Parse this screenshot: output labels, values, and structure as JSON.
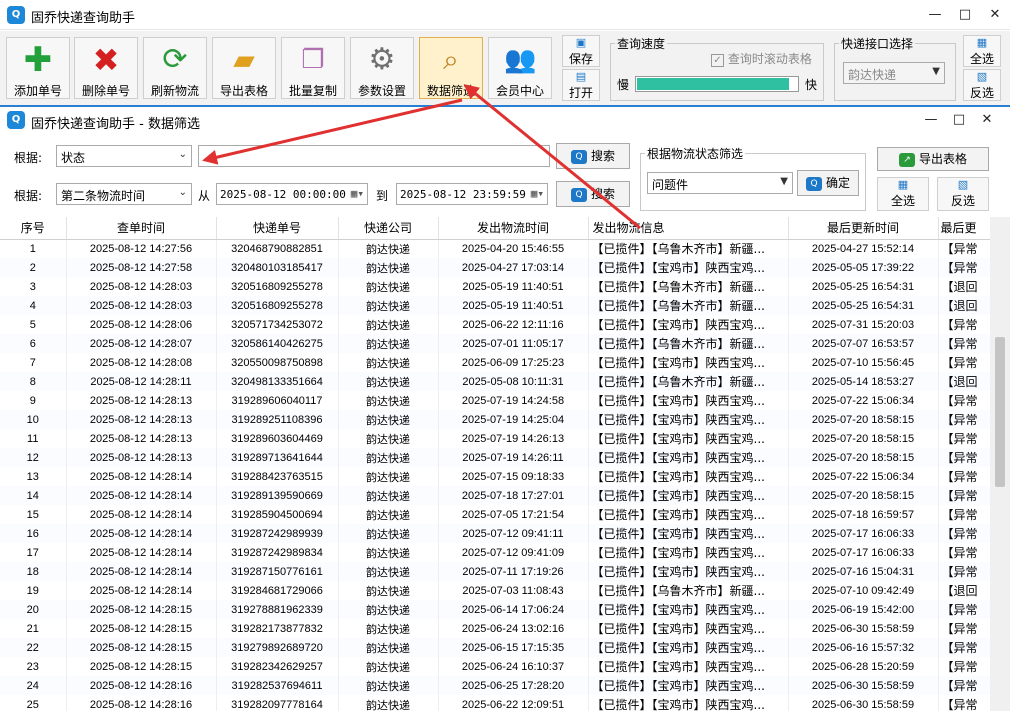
{
  "app": {
    "title": "固乔快递查询助手",
    "child_title": "固乔快递查询助手 - 数据筛选",
    "logo_text": "Q"
  },
  "window_controls": {
    "minimize": "—",
    "maximize": "□",
    "close": "✕"
  },
  "toolbar": {
    "buttons": [
      {
        "label": "添加单号",
        "icon": "plus-icon"
      },
      {
        "label": "删除单号",
        "icon": "delete-icon"
      },
      {
        "label": "刷新物流",
        "icon": "refresh-icon"
      },
      {
        "label": "导出表格",
        "icon": "export-folder-icon"
      },
      {
        "label": "批量复制",
        "icon": "copy-icon"
      },
      {
        "label": "参数设置",
        "icon": "gear-icon"
      },
      {
        "label": "数据筛选",
        "icon": "magnifier-icon"
      },
      {
        "label": "会员中心",
        "icon": "users-icon"
      }
    ],
    "save_label": "保存",
    "open_label": "打开",
    "speed_group_title": "查询速度",
    "auto_scroll_label": "查询时滚动表格",
    "slow_label": "慢",
    "fast_label": "快",
    "speed_value": 0.95,
    "courier_group_title": "快递接口选择",
    "courier_selected": "韵达快递",
    "select_all_label": "全选",
    "invert_label": "反选"
  },
  "filter": {
    "basis_label_1": "根据:",
    "basis_select_1": "状态",
    "search_label": "搜索",
    "basis_label_2": "根据:",
    "basis_select_2": "第二条物流时间",
    "from_label": "从",
    "from_value": "2025-08-12 00:00:00",
    "to_label": "到",
    "to_value": "2025-08-12 23:59:59",
    "status_group_title": "根据物流状态筛选",
    "status_selected": "问题件",
    "confirm_label": "确定",
    "export_label": "导出表格",
    "select_all_label": "全选",
    "invert_label": "反选"
  },
  "table": {
    "headers": [
      "序号",
      "查单时间",
      "快递单号",
      "快递公司",
      "发出物流时间",
      "发出物流信息",
      "最后更新时间",
      "最后更"
    ],
    "rows": [
      [
        "1",
        "2025-08-12 14:27:56",
        "320468790882851",
        "韵达快递",
        "2025-04-20 15:46:55",
        "【已揽件】【乌鲁木齐市】新疆...",
        "2025-04-27 15:52:14",
        "【异常"
      ],
      [
        "2",
        "2025-08-12 14:27:58",
        "320480103185417",
        "韵达快递",
        "2025-04-27 17:03:14",
        "【已揽件】【宝鸡市】陕西宝鸡...",
        "2025-05-05 17:39:22",
        "【异常"
      ],
      [
        "3",
        "2025-08-12 14:28:03",
        "320516809255278",
        "韵达快递",
        "2025-05-19 11:40:51",
        "【已揽件】【乌鲁木齐市】新疆...",
        "2025-05-25 16:54:31",
        "【退回"
      ],
      [
        "4",
        "2025-08-12 14:28:03",
        "320516809255278",
        "韵达快递",
        "2025-05-19 11:40:51",
        "【已揽件】【乌鲁木齐市】新疆...",
        "2025-05-25 16:54:31",
        "【退回"
      ],
      [
        "5",
        "2025-08-12 14:28:06",
        "320571734253072",
        "韵达快递",
        "2025-06-22 12:11:16",
        "【已揽件】【宝鸡市】陕西宝鸡...",
        "2025-07-31 15:20:03",
        "【异常"
      ],
      [
        "6",
        "2025-08-12 14:28:07",
        "320586140426275",
        "韵达快递",
        "2025-07-01 11:05:17",
        "【已揽件】【乌鲁木齐市】新疆...",
        "2025-07-07 16:53:57",
        "【异常"
      ],
      [
        "7",
        "2025-08-12 14:28:08",
        "320550098750898",
        "韵达快递",
        "2025-06-09 17:25:23",
        "【已揽件】【宝鸡市】陕西宝鸡...",
        "2025-07-10 15:56:45",
        "【异常"
      ],
      [
        "8",
        "2025-08-12 14:28:11",
        "320498133351664",
        "韵达快递",
        "2025-05-08 10:11:31",
        "【已揽件】【乌鲁木齐市】新疆...",
        "2025-05-14 18:53:27",
        "【退回"
      ],
      [
        "9",
        "2025-08-12 14:28:13",
        "319289606040117",
        "韵达快递",
        "2025-07-19 14:24:58",
        "【已揽件】【宝鸡市】陕西宝鸡...",
        "2025-07-22 15:06:34",
        "【异常"
      ],
      [
        "10",
        "2025-08-12 14:28:13",
        "319289251108396",
        "韵达快递",
        "2025-07-19 14:25:04",
        "【已揽件】【宝鸡市】陕西宝鸡...",
        "2025-07-20 18:58:15",
        "【异常"
      ],
      [
        "11",
        "2025-08-12 14:28:13",
        "319289603604469",
        "韵达快递",
        "2025-07-19 14:26:13",
        "【已揽件】【宝鸡市】陕西宝鸡...",
        "2025-07-20 18:58:15",
        "【异常"
      ],
      [
        "12",
        "2025-08-12 14:28:13",
        "319289713641644",
        "韵达快递",
        "2025-07-19 14:26:11",
        "【已揽件】【宝鸡市】陕西宝鸡...",
        "2025-07-20 18:58:15",
        "【异常"
      ],
      [
        "13",
        "2025-08-12 14:28:14",
        "319288423763515",
        "韵达快递",
        "2025-07-15 09:18:33",
        "【已揽件】【宝鸡市】陕西宝鸡...",
        "2025-07-22 15:06:34",
        "【异常"
      ],
      [
        "14",
        "2025-08-12 14:28:14",
        "319289139590669",
        "韵达快递",
        "2025-07-18 17:27:01",
        "【已揽件】【宝鸡市】陕西宝鸡...",
        "2025-07-20 18:58:15",
        "【异常"
      ],
      [
        "15",
        "2025-08-12 14:28:14",
        "319285904500694",
        "韵达快递",
        "2025-07-05 17:21:54",
        "【已揽件】【宝鸡市】陕西宝鸡...",
        "2025-07-18 16:59:57",
        "【异常"
      ],
      [
        "16",
        "2025-08-12 14:28:14",
        "319287242989939",
        "韵达快递",
        "2025-07-12 09:41:11",
        "【已揽件】【宝鸡市】陕西宝鸡...",
        "2025-07-17 16:06:33",
        "【异常"
      ],
      [
        "17",
        "2025-08-12 14:28:14",
        "319287242989834",
        "韵达快递",
        "2025-07-12 09:41:09",
        "【已揽件】【宝鸡市】陕西宝鸡...",
        "2025-07-17 16:06:33",
        "【异常"
      ],
      [
        "18",
        "2025-08-12 14:28:14",
        "319287150776161",
        "韵达快递",
        "2025-07-11 17:19:26",
        "【已揽件】【宝鸡市】陕西宝鸡...",
        "2025-07-16 15:04:31",
        "【异常"
      ],
      [
        "19",
        "2025-08-12 14:28:14",
        "319284681729066",
        "韵达快递",
        "2025-07-03 11:08:43",
        "【已揽件】【乌鲁木齐市】新疆...",
        "2025-07-10 09:42:49",
        "【退回"
      ],
      [
        "20",
        "2025-08-12 14:28:15",
        "319278881962339",
        "韵达快递",
        "2025-06-14 17:06:24",
        "【已揽件】【宝鸡市】陕西宝鸡...",
        "2025-06-19 15:42:00",
        "【异常"
      ],
      [
        "21",
        "2025-08-12 14:28:15",
        "319282173877832",
        "韵达快递",
        "2025-06-24 13:02:16",
        "【已揽件】【宝鸡市】陕西宝鸡...",
        "2025-06-30 15:58:59",
        "【异常"
      ],
      [
        "22",
        "2025-08-12 14:28:15",
        "319279892689720",
        "韵达快递",
        "2025-06-15 17:15:35",
        "【已揽件】【宝鸡市】陕西宝鸡...",
        "2025-06-16 15:57:32",
        "【异常"
      ],
      [
        "23",
        "2025-08-12 14:28:15",
        "319282342629257",
        "韵达快递",
        "2025-06-24 16:10:37",
        "【已揽件】【宝鸡市】陕西宝鸡...",
        "2025-06-28 15:20:59",
        "【异常"
      ],
      [
        "24",
        "2025-08-12 14:28:16",
        "319282537694611",
        "韵达快递",
        "2025-06-25 17:28:20",
        "【已揽件】【宝鸡市】陕西宝鸡...",
        "2025-06-30 15:58:59",
        "【异常"
      ],
      [
        "25",
        "2025-08-12 14:28:16",
        "319282097778164",
        "韵达快递",
        "2025-06-22 12:09:51",
        "【已揽件】【宝鸡市】陕西宝鸡...",
        "2025-06-30 15:58:59",
        "【异常"
      ]
    ]
  },
  "colors": {
    "accent": "#2a7fd4",
    "progress": "#2ec0a0",
    "arrow": "#e03030"
  }
}
